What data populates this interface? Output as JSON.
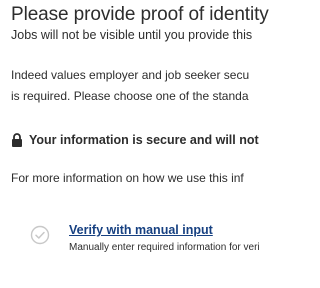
{
  "page": {
    "title": "Please provide proof of identity",
    "subtitle": "Jobs will not be visible until you provide this",
    "para_line1": "Indeed values employer and job seeker secu",
    "para_line2": "is required. Please choose one of the standa",
    "secure_notice": "Your information is secure and will not",
    "info_line": "For more information on how we use this inf"
  },
  "icons": {
    "lock": "lock-icon",
    "check": "check-circle-icon"
  },
  "option": {
    "title": "Verify with manual input",
    "description": "Manually enter required information for veri"
  },
  "colors": {
    "text": "#2d2d2d",
    "link": "#164081",
    "check": "#c8c8c8"
  }
}
